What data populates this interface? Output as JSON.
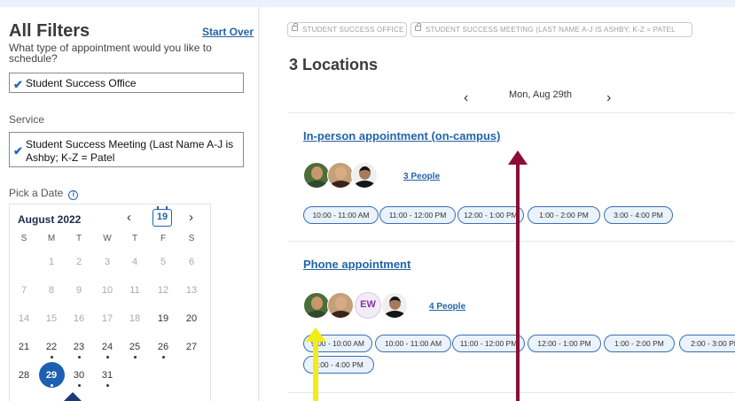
{
  "filters": {
    "title": "All Filters",
    "start_over": "Start Over",
    "question": "What type of appointment would you like to schedule?",
    "selected_office": "Student Success Office",
    "service_label": "Service",
    "selected_service": "Student Success Meeting (Last Name A-J is Ashby; K-Z = Patel",
    "date_label": "Pick a Date",
    "info_icon": "i"
  },
  "calendar": {
    "month": "August 2022",
    "prev": "‹",
    "next": "›",
    "today_badge": "19",
    "weekdays": [
      "S",
      "M",
      "T",
      "W",
      "T",
      "F",
      "S"
    ],
    "weeks": [
      [
        "",
        "1",
        "2",
        "3",
        "4",
        "5",
        "6"
      ],
      [
        "7",
        "8",
        "9",
        "10",
        "11",
        "12",
        "13"
      ],
      [
        "14",
        "15",
        "16",
        "17",
        "18",
        "19",
        "20"
      ],
      [
        "21",
        "22",
        "23",
        "24",
        "25",
        "26",
        "27"
      ],
      [
        "28",
        "29",
        "30",
        "31",
        "",
        "",
        ""
      ]
    ],
    "selected_day": "29"
  },
  "breadcrumbs": [
    "Student Success Office",
    "Student Success Meeting (Last Name A-J is Ashby; K-Z = Patel"
  ],
  "results": {
    "count_title": "3 Locations",
    "date_prev": "‹",
    "date": "Mon, Aug 29th",
    "date_next": "›"
  },
  "locations": [
    {
      "title": "In-person appointment (on-campus)",
      "people": "3 People",
      "slots": [
        "10:00 - 11:00 AM",
        "11:00 - 12:00 PM",
        "12:00 - 1:00 PM",
        "1:00 - 2:00 PM",
        "3:00 - 4:00 PM"
      ]
    },
    {
      "title": "Phone appointment",
      "people": "4 People",
      "avatar_initials": "EW",
      "slots": [
        "9:00 - 10:00 AM",
        "10:00 - 11:00 AM",
        "11:00 - 12:00 PM",
        "12:00 - 1:00 PM",
        "1:00 - 2:00 PM",
        "2:00 - 3:00 PM",
        "3:00 - 4:00 PM"
      ]
    }
  ],
  "colors": {
    "accent": "#2463a8",
    "selected_day": "#1d5fb3",
    "annotation_red": "#8b0d33",
    "annotation_yellow": "#f2ec18",
    "annotation_navy": "#1b3b72"
  }
}
